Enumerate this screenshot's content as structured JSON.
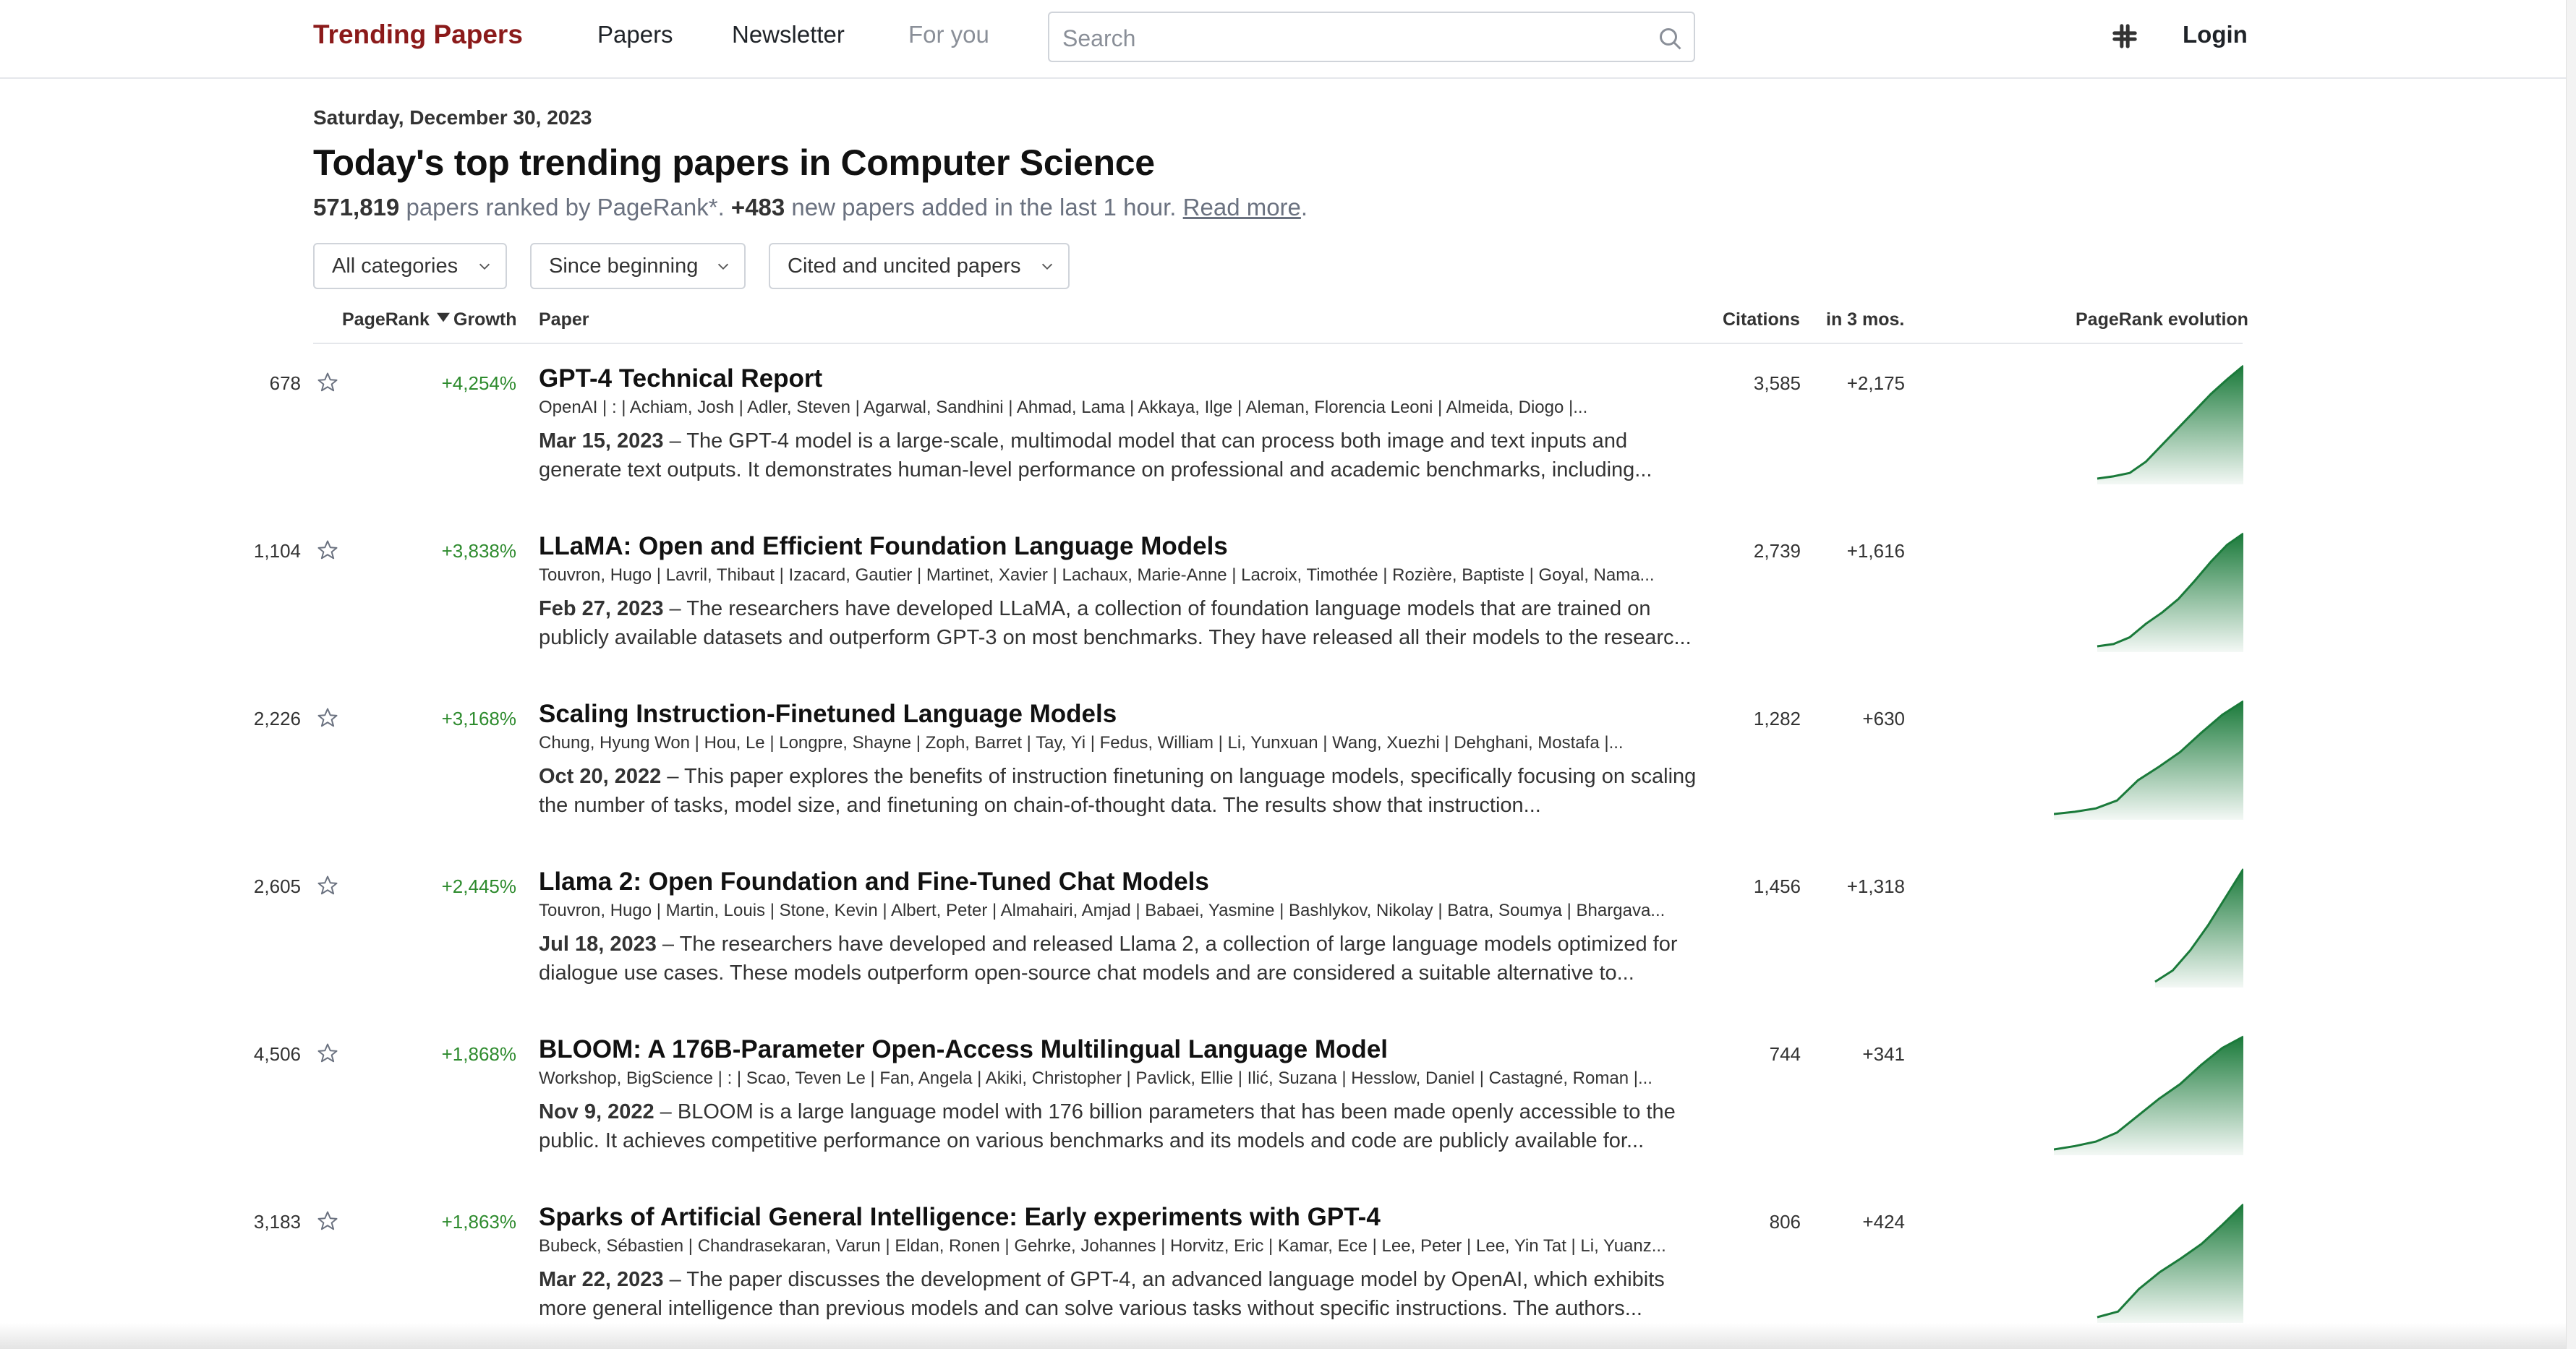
{
  "header": {
    "brand": "Trending Papers",
    "nav": [
      "Papers",
      "Newsletter",
      "For you"
    ],
    "search_placeholder": "Search",
    "login": "Login"
  },
  "intro": {
    "date": "Saturday, December 30, 2023",
    "title": "Today's top trending papers in Computer Science",
    "count": "571,819",
    "count_suffix": " papers ranked by PageRank*. ",
    "added": "+483",
    "added_suffix": " new papers added in the last 1 hour. ",
    "read_more": "Read more",
    "period": "."
  },
  "filters": [
    "All categories",
    "Since beginning",
    "Cited and uncited papers"
  ],
  "columns": {
    "pagerank": "PageRank",
    "growth": "Growth",
    "paper": "Paper",
    "citations": "Citations",
    "in3": "in 3 mos.",
    "evolution": "PageRank evolution"
  },
  "colors": {
    "brand": "#8b1a1a",
    "growth": "#2e8b2e",
    "spark": "#1a7a3a"
  },
  "papers": [
    {
      "rank": "678",
      "growth": "+4,254%",
      "title": "GPT-4 Technical Report",
      "authors": "OpenAI | : | Achiam, Josh | Adler, Steven | Agarwal, Sandhini | Ahmad, Lama | Akkaya, Ilge | Aleman, Florencia Leoni | Almeida, Diogo |...",
      "date": "Mar 15, 2023",
      "abstract": " – The GPT-4 model is a large-scale, multimodal model that can process both image and text inputs and generate text outputs. It demonstrates human-level performance on professional and academic benchmarks, including...",
      "citations": "3,585",
      "in3": "+2,175",
      "spark": [
        0.0,
        0.02,
        0.05,
        0.15,
        0.3,
        0.45,
        0.6,
        0.75,
        0.88,
        1.0
      ]
    },
    {
      "rank": "1,104",
      "growth": "+3,838%",
      "title": "LLaMA: Open and Efficient Foundation Language Models",
      "authors": "Touvron, Hugo | Lavril, Thibaut | Izacard, Gautier | Martinet, Xavier | Lachaux, Marie-Anne | Lacroix, Timothée | Rozière, Baptiste | Goyal, Nama...",
      "date": "Feb 27, 2023",
      "abstract": " – The researchers have developed LLaMA, a collection of foundation language models that are trained on publicly available datasets and outperform GPT-3 on most benchmarks. They have released all their models to the researc...",
      "citations": "2,739",
      "in3": "+1,616",
      "spark": [
        0.0,
        0.02,
        0.08,
        0.2,
        0.3,
        0.42,
        0.58,
        0.75,
        0.9,
        1.0
      ]
    },
    {
      "rank": "2,226",
      "growth": "+3,168%",
      "title": "Scaling Instruction-Finetuned Language Models",
      "authors": "Chung, Hyung Won | Hou, Le | Longpre, Shayne | Zoph, Barret | Tay, Yi | Fedus, William | Li, Yunxuan | Wang, Xuezhi | Dehghani, Mostafa |...",
      "date": "Oct 20, 2022",
      "abstract": " – This paper explores the benefits of instruction finetuning on language models, specifically focusing on scaling the number of tasks, model size, and finetuning on chain-of-thought data. The results show that instruction...",
      "citations": "1,282",
      "in3": "+630",
      "spark": [
        0.0,
        0.02,
        0.05,
        0.12,
        0.3,
        0.42,
        0.55,
        0.72,
        0.88,
        1.0
      ]
    },
    {
      "rank": "2,605",
      "growth": "+2,445%",
      "title": "Llama 2: Open Foundation and Fine-Tuned Chat Models",
      "authors": "Touvron, Hugo | Martin, Louis | Stone, Kevin | Albert, Peter | Almahairi, Amjad | Babaei, Yasmine | Bashlykov, Nikolay | Batra, Soumya | Bhargava...",
      "date": "Jul 18, 2023",
      "abstract": " – The researchers have developed and released Llama 2, a collection of large language models optimized for dialogue use cases. These models outperform open-source chat models and are considered a suitable alternative to...",
      "citations": "1,456",
      "in3": "+1,318",
      "spark": [
        0.0,
        0.1,
        0.28,
        0.5,
        0.75,
        1.0
      ]
    },
    {
      "rank": "4,506",
      "growth": "+1,868%",
      "title": "BLOOM: A 176B-Parameter Open-Access Multilingual Language Model",
      "authors": "Workshop, BigScience | : | Scao, Teven Le | Fan, Angela | Akiki, Christopher | Pavlick, Ellie | Ilić, Suzana | Hesslow, Daniel | Castagné, Roman |...",
      "date": "Nov 9, 2022",
      "abstract": " – BLOOM is a large language model with 176 billion parameters that has been made openly accessible to the public. It achieves competitive performance on various benchmarks and its models and code are publicly available for...",
      "citations": "744",
      "in3": "+341",
      "spark": [
        0.0,
        0.03,
        0.07,
        0.15,
        0.3,
        0.45,
        0.58,
        0.75,
        0.9,
        1.0
      ]
    },
    {
      "rank": "3,183",
      "growth": "+1,863%",
      "title": "Sparks of Artificial General Intelligence: Early experiments with GPT-4",
      "authors": "Bubeck, Sébastien | Chandrasekaran, Varun | Eldan, Ronen | Gehrke, Johannes | Horvitz, Eric | Kamar, Ece | Lee, Peter | Lee, Yin Tat | Li, Yuanz...",
      "date": "Mar 22, 2023",
      "abstract": " – The paper discusses the development of GPT-4, an advanced language model by OpenAI, which exhibits more general intelligence than previous models and can solve various tasks without specific instructions. The authors...",
      "citations": "806",
      "in3": "+424",
      "spark": [
        0.0,
        0.05,
        0.25,
        0.4,
        0.52,
        0.65,
        0.82,
        1.0
      ]
    }
  ]
}
